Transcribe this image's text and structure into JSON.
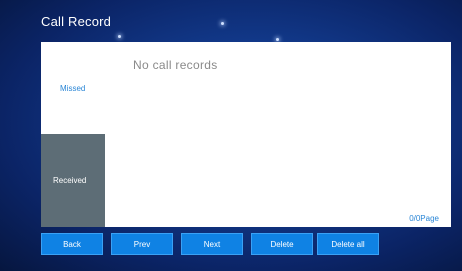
{
  "title": "Call Record",
  "panel": {
    "empty_message": "No call records",
    "page_indicator": "0/0Page"
  },
  "tabs": [
    {
      "label": "Missed",
      "selected": false
    },
    {
      "label": "Received",
      "selected": true
    }
  ],
  "buttons": {
    "back": "Back",
    "prev": "Prev",
    "next": "Next",
    "delete": "Delete",
    "delete_all": "Delete all"
  },
  "colors": {
    "accent": "#0f82e4",
    "selected_tab": "#5d6d76",
    "link_text": "#2a86d6",
    "background": "#123a8c"
  }
}
